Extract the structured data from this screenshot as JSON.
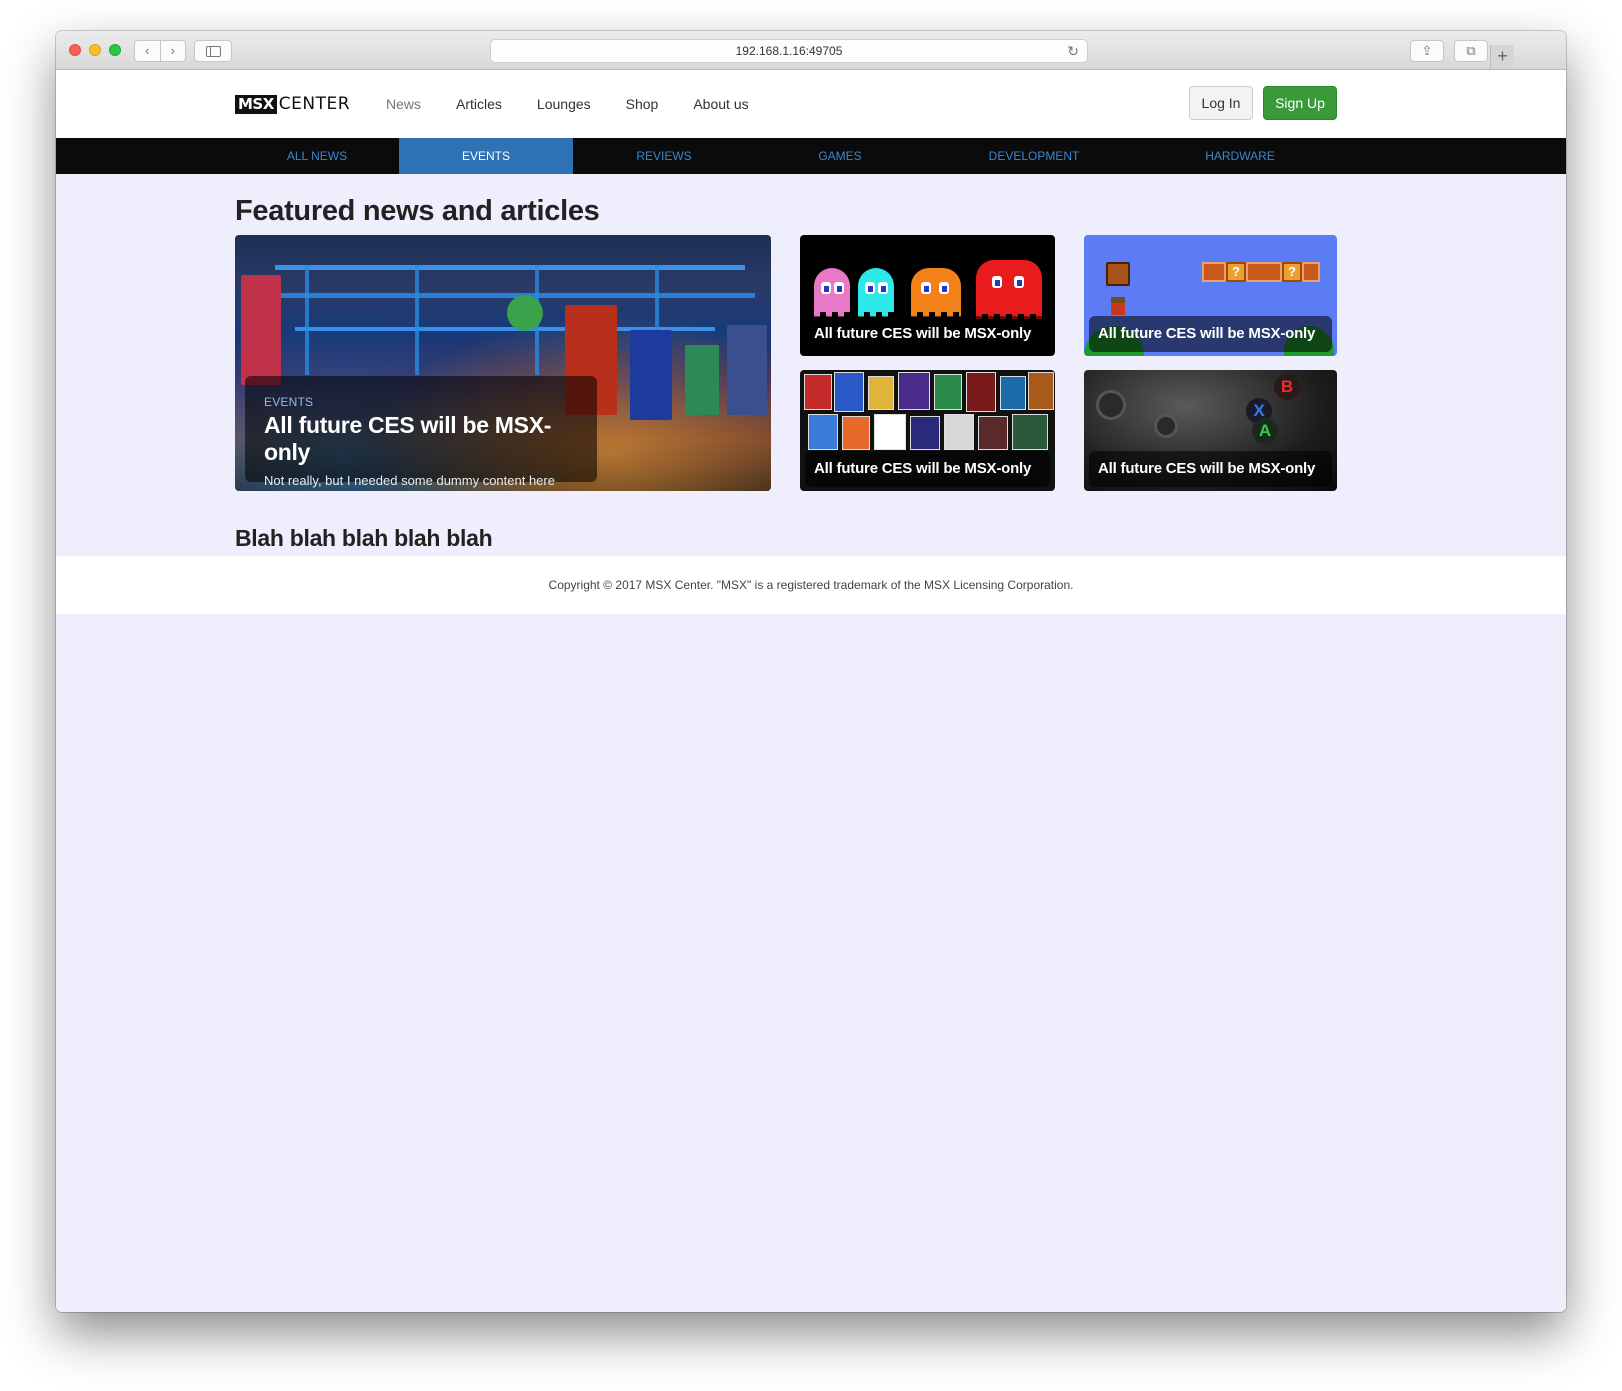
{
  "browser": {
    "url": "192.168.1.16:49705",
    "nav_back": "‹",
    "nav_forward": "›",
    "reload_icon": "↻",
    "share_icon": "⇪",
    "tabs_icon": "⧉",
    "new_tab_icon": "+"
  },
  "site": {
    "logo_mark": "MSX",
    "logo_text": "CENTER",
    "nav": [
      {
        "label": "News"
      },
      {
        "label": "Articles"
      },
      {
        "label": "Lounges"
      },
      {
        "label": "Shop"
      },
      {
        "label": "About us"
      }
    ],
    "login_label": "Log In",
    "signup_label": "Sign Up",
    "signup_color": "#3a9a3a",
    "accent_color": "#2f71b5"
  },
  "categories": [
    {
      "label": "ALL NEWS",
      "active": false
    },
    {
      "label": "EVENTS",
      "active": true
    },
    {
      "label": "REVIEWS",
      "active": false
    },
    {
      "label": "GAMES",
      "active": false
    },
    {
      "label": "DEVELOPMENT",
      "active": false
    },
    {
      "label": "HARDWARE",
      "active": false
    }
  ],
  "featured": {
    "heading": "Featured news and articles",
    "main": {
      "category": "EVENTS",
      "title": "All future CES will be MSX-only",
      "description": "Not really, but I needed some dummy content here",
      "image": "arcade-hall-photo"
    },
    "cards": [
      {
        "title": "All future CES will be MSX-only",
        "image": "pacman-ghosts"
      },
      {
        "title": "All future CES will be MSX-only",
        "image": "mario-level"
      },
      {
        "title": "All future CES will be MSX-only",
        "image": "game-covers-collage"
      },
      {
        "title": "All future CES will be MSX-only",
        "image": "game-controller"
      }
    ]
  },
  "second_heading": "Blah blah blah blah blah",
  "footer": {
    "copyright": "Copyright © 2017 MSX Center. \"MSX\" is a registered trademark of the MSX Licensing Corporation."
  }
}
